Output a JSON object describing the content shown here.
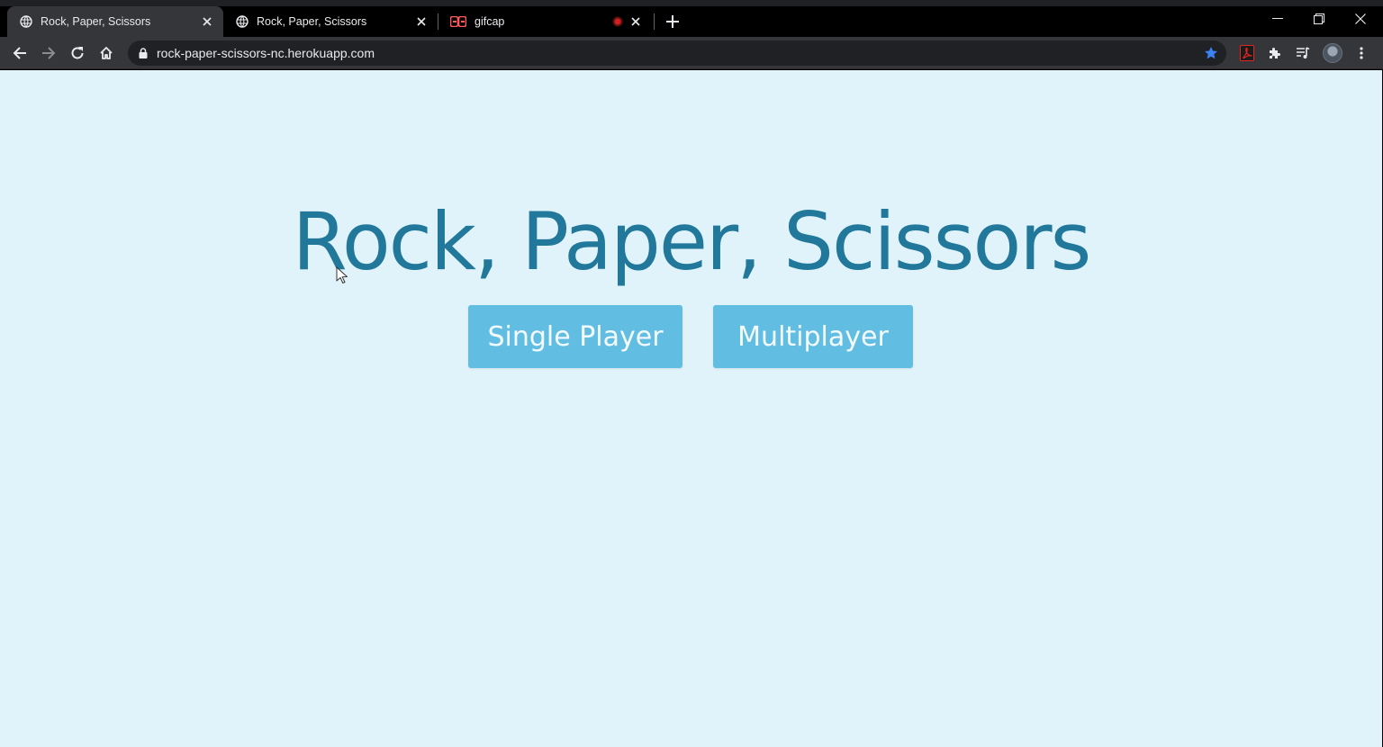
{
  "browser": {
    "tabs": [
      {
        "title": "Rock, Paper, Scissors",
        "active": true,
        "favicon": "globe-icon"
      },
      {
        "title": "Rock, Paper, Scissors",
        "active": false,
        "favicon": "globe-icon"
      },
      {
        "title": "gifcap",
        "active": false,
        "favicon": "gifcap-logo-icon",
        "recording": true
      }
    ],
    "url": "rock-paper-scissors-nc.herokuapp.com",
    "bookmarked": true,
    "accent_color": "#3b82f6"
  },
  "page": {
    "title": "Rock, Paper, Scissors",
    "buttons": {
      "single_player": "Single Player",
      "multiplayer": "Multiplayer"
    },
    "colors": {
      "background": "#e1f3fa",
      "title": "#21789a",
      "button": "#62bde3",
      "button_text": "#f4fbff"
    }
  }
}
